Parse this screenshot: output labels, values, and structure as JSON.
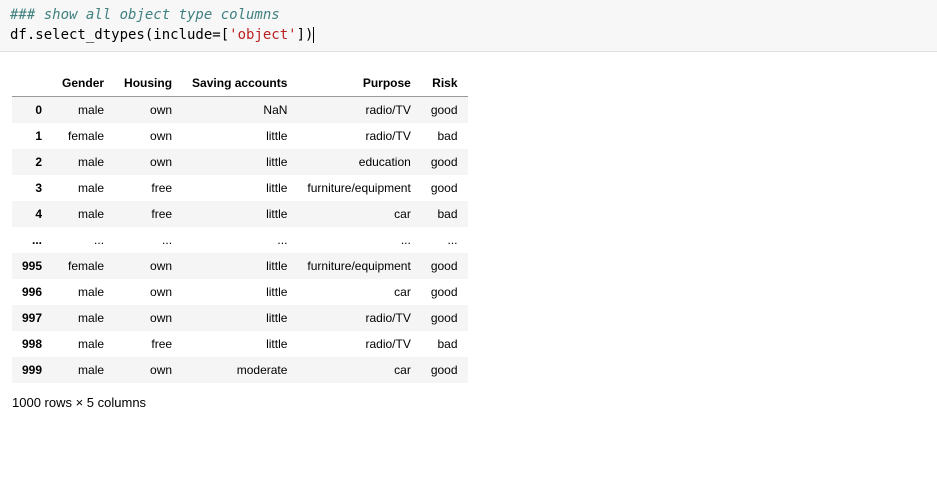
{
  "code": {
    "comment": "### show all object type columns",
    "line_prefix": "df.select_dtypes(include=[",
    "string_literal": "'object'",
    "line_suffix": "])"
  },
  "table": {
    "columns": [
      "Gender",
      "Housing",
      "Saving accounts",
      "Purpose",
      "Risk"
    ],
    "rows_top": [
      {
        "idx": "0",
        "cells": [
          "male",
          "own",
          "NaN",
          "radio/TV",
          "good"
        ]
      },
      {
        "idx": "1",
        "cells": [
          "female",
          "own",
          "little",
          "radio/TV",
          "bad"
        ]
      },
      {
        "idx": "2",
        "cells": [
          "male",
          "own",
          "little",
          "education",
          "good"
        ]
      },
      {
        "idx": "3",
        "cells": [
          "male",
          "free",
          "little",
          "furniture/equipment",
          "good"
        ]
      },
      {
        "idx": "4",
        "cells": [
          "male",
          "free",
          "little",
          "car",
          "bad"
        ]
      }
    ],
    "rows_bottom": [
      {
        "idx": "995",
        "cells": [
          "female",
          "own",
          "little",
          "furniture/equipment",
          "good"
        ]
      },
      {
        "idx": "996",
        "cells": [
          "male",
          "own",
          "little",
          "car",
          "good"
        ]
      },
      {
        "idx": "997",
        "cells": [
          "male",
          "own",
          "little",
          "radio/TV",
          "good"
        ]
      },
      {
        "idx": "998",
        "cells": [
          "male",
          "free",
          "little",
          "radio/TV",
          "bad"
        ]
      },
      {
        "idx": "999",
        "cells": [
          "male",
          "own",
          "moderate",
          "car",
          "good"
        ]
      }
    ],
    "ellipsis": "...",
    "summary": "1000 rows × 5 columns"
  }
}
